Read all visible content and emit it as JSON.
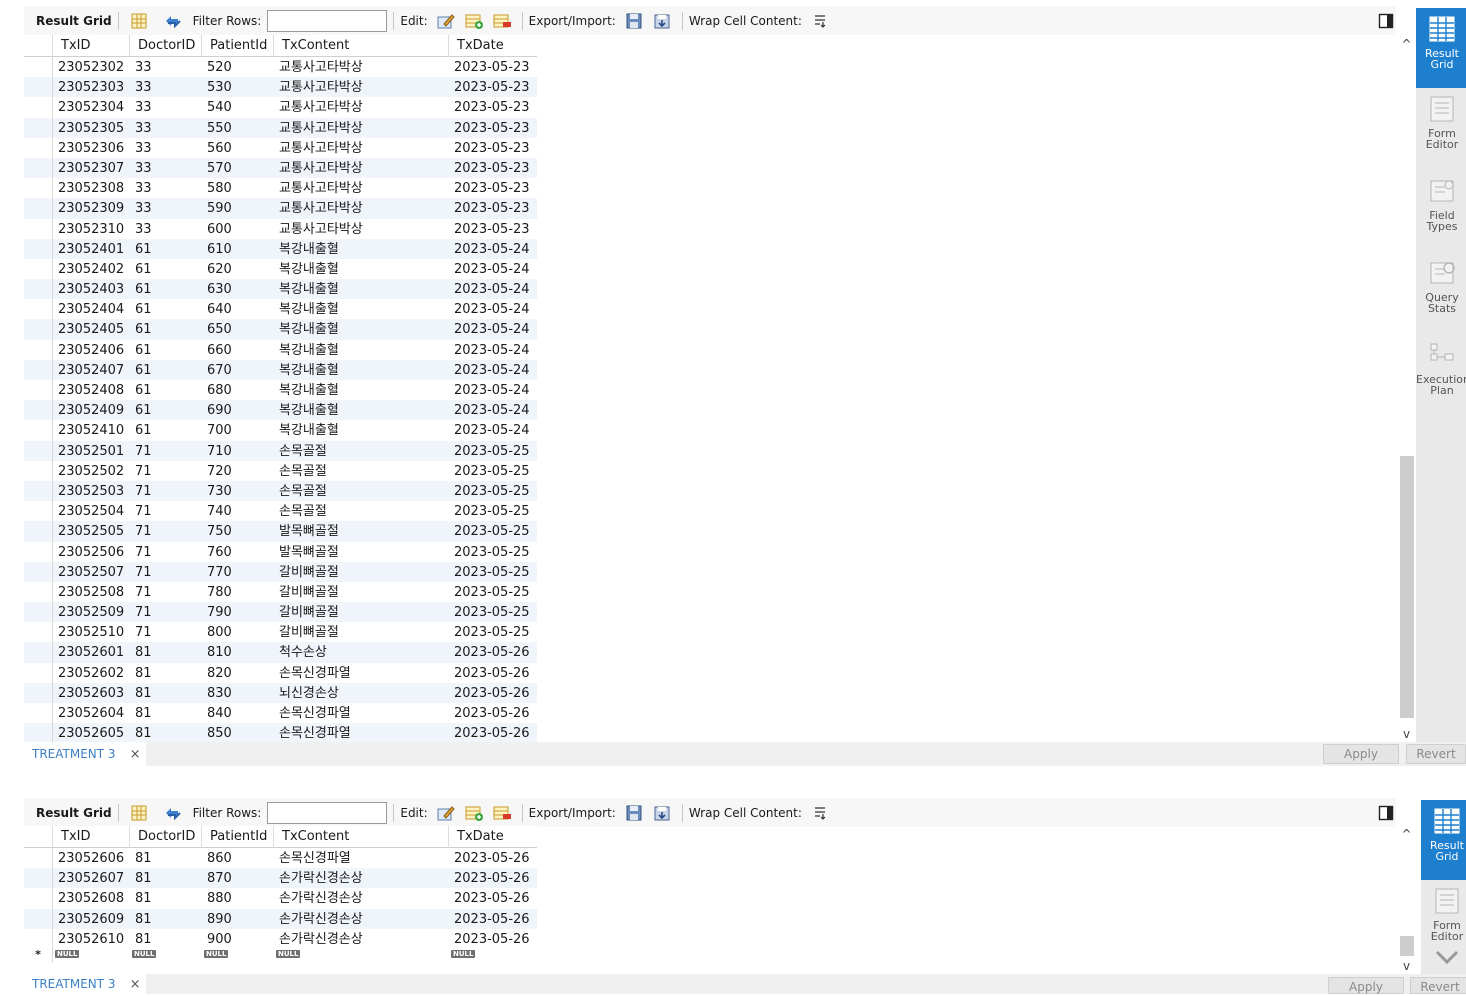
{
  "toolbar": {
    "result_grid": "Result Grid",
    "filter_rows": "Filter Rows:",
    "edit": "Edit:",
    "export_import": "Export/Import:",
    "wrap_cell_content": "Wrap Cell Content:"
  },
  "columns": [
    "TxID",
    "DoctorID",
    "PatientId",
    "TxContent",
    "TxDate"
  ],
  "side_panel": {
    "result_grid": "Result\nGrid",
    "form_editor": "Form\nEditor",
    "field_types": "Field\nTypes",
    "query_stats": "Query\nStats",
    "execution_plan": "Execution\nPlan"
  },
  "side_panel2": {
    "result_grid": "Result\nGrid",
    "form_editor": "Form\nEditor"
  },
  "tab_label": "TREATMENT 3",
  "tab_close": "×",
  "apply_label": "Apply",
  "revert_label": "Revert",
  "null_label": "NULL",
  "new_row_marker": "*",
  "panel1_rows": [
    [
      "23052302",
      "33",
      "520",
      "교통사고타박상",
      "2023-05-23"
    ],
    [
      "23052303",
      "33",
      "530",
      "교통사고타박상",
      "2023-05-23"
    ],
    [
      "23052304",
      "33",
      "540",
      "교통사고타박상",
      "2023-05-23"
    ],
    [
      "23052305",
      "33",
      "550",
      "교통사고타박상",
      "2023-05-23"
    ],
    [
      "23052306",
      "33",
      "560",
      "교통사고타박상",
      "2023-05-23"
    ],
    [
      "23052307",
      "33",
      "570",
      "교통사고타박상",
      "2023-05-23"
    ],
    [
      "23052308",
      "33",
      "580",
      "교통사고타박상",
      "2023-05-23"
    ],
    [
      "23052309",
      "33",
      "590",
      "교통사고타박상",
      "2023-05-23"
    ],
    [
      "23052310",
      "33",
      "600",
      "교통사고타박상",
      "2023-05-23"
    ],
    [
      "23052401",
      "61",
      "610",
      "복강내출혈",
      "2023-05-24"
    ],
    [
      "23052402",
      "61",
      "620",
      "복강내출혈",
      "2023-05-24"
    ],
    [
      "23052403",
      "61",
      "630",
      "복강내출혈",
      "2023-05-24"
    ],
    [
      "23052404",
      "61",
      "640",
      "복강내출혈",
      "2023-05-24"
    ],
    [
      "23052405",
      "61",
      "650",
      "복강내출혈",
      "2023-05-24"
    ],
    [
      "23052406",
      "61",
      "660",
      "복강내출혈",
      "2023-05-24"
    ],
    [
      "23052407",
      "61",
      "670",
      "복강내출혈",
      "2023-05-24"
    ],
    [
      "23052408",
      "61",
      "680",
      "복강내출혈",
      "2023-05-24"
    ],
    [
      "23052409",
      "61",
      "690",
      "복강내출혈",
      "2023-05-24"
    ],
    [
      "23052410",
      "61",
      "700",
      "복강내출혈",
      "2023-05-24"
    ],
    [
      "23052501",
      "71",
      "710",
      "손목골절",
      "2023-05-25"
    ],
    [
      "23052502",
      "71",
      "720",
      "손목골절",
      "2023-05-25"
    ],
    [
      "23052503",
      "71",
      "730",
      "손목골절",
      "2023-05-25"
    ],
    [
      "23052504",
      "71",
      "740",
      "손목골절",
      "2023-05-25"
    ],
    [
      "23052505",
      "71",
      "750",
      "발목뼈골절",
      "2023-05-25"
    ],
    [
      "23052506",
      "71",
      "760",
      "발목뼈골절",
      "2023-05-25"
    ],
    [
      "23052507",
      "71",
      "770",
      "갈비뼈골절",
      "2023-05-25"
    ],
    [
      "23052508",
      "71",
      "780",
      "갈비뼈골절",
      "2023-05-25"
    ],
    [
      "23052509",
      "71",
      "790",
      "갈비뼈골절",
      "2023-05-25"
    ],
    [
      "23052510",
      "71",
      "800",
      "갈비뼈골절",
      "2023-05-25"
    ],
    [
      "23052601",
      "81",
      "810",
      "척수손상",
      "2023-05-26"
    ],
    [
      "23052602",
      "81",
      "820",
      "손목신경파열",
      "2023-05-26"
    ],
    [
      "23052603",
      "81",
      "830",
      "뇌신경손상",
      "2023-05-26"
    ],
    [
      "23052604",
      "81",
      "840",
      "손목신경파열",
      "2023-05-26"
    ],
    [
      "23052605",
      "81",
      "850",
      "손목신경파열",
      "2023-05-26"
    ]
  ],
  "panel2_rows": [
    [
      "23052606",
      "81",
      "860",
      "손목신경파열",
      "2023-05-26"
    ],
    [
      "23052607",
      "81",
      "870",
      "손가락신경손상",
      "2023-05-26"
    ],
    [
      "23052608",
      "81",
      "880",
      "손가락신경손상",
      "2023-05-26"
    ],
    [
      "23052609",
      "81",
      "890",
      "손가락신경손상",
      "2023-05-26"
    ],
    [
      "23052610",
      "81",
      "900",
      "손가락신경손상",
      "2023-05-26"
    ]
  ]
}
